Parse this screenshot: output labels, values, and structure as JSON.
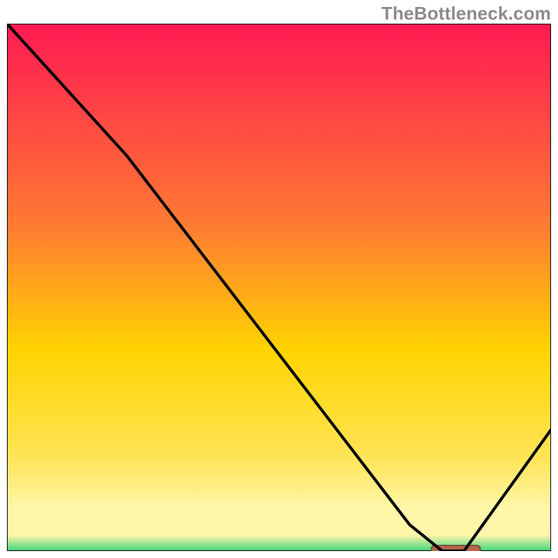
{
  "watermark": "TheBottleneck.com",
  "colors": {
    "top": "#ff1a52",
    "mid1": "#ff7a33",
    "mid2": "#ffd400",
    "mid3": "#ffe455",
    "mid4": "#fff6aa",
    "bottom": "#3fd47a",
    "curve": "#000000",
    "marker": "#b4664e",
    "marker_stroke": "#6b3f31",
    "border": "#000000"
  },
  "chart_data": {
    "type": "line",
    "title": "",
    "xlabel": "",
    "ylabel": "",
    "xlim": [
      0,
      100
    ],
    "ylim": [
      0,
      100
    ],
    "series": [
      {
        "name": "bottleneck-curve",
        "x": [
          0,
          22,
          74,
          80,
          84,
          100
        ],
        "y": [
          100,
          75,
          5,
          0,
          0,
          23
        ]
      }
    ],
    "marker": {
      "x_start": 78,
      "x_end": 87,
      "y": 0
    },
    "annotations": []
  }
}
